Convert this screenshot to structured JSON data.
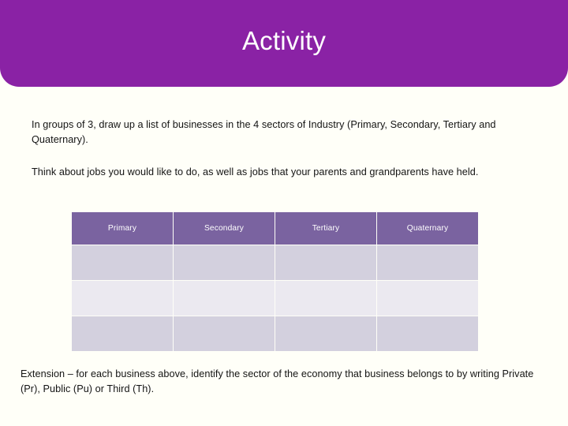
{
  "slide": {
    "title": "Activity",
    "background_color": "#FFFFF8",
    "banner_color": "#8A22A5",
    "title_color": "#FFFFFF"
  },
  "body": {
    "paragraph_1": "In groups of 3, draw up a list of businesses in the 4 sectors of Industry (Primary, Secondary, Tertiary and Quaternary).",
    "paragraph_2": "Think about jobs you would like to do, as well as jobs that your parents and grandparents have held.",
    "extension": "Extension – for each business above, identify the sector of the economy that business belongs to by writing Private (Pr), Public (Pu) or Third (Th)."
  },
  "table": {
    "header_bg": "#7A63A0",
    "header_text_color": "#FFFFFF",
    "row_shade_color": "#D3D0DE",
    "row_light_color": "#EBE9F0",
    "columns": [
      "Primary",
      "Secondary",
      "Tertiary",
      "Quaternary"
    ],
    "rows": [
      [
        "",
        "",
        "",
        ""
      ],
      [
        "",
        "",
        "",
        ""
      ],
      [
        "",
        "",
        "",
        ""
      ]
    ]
  }
}
